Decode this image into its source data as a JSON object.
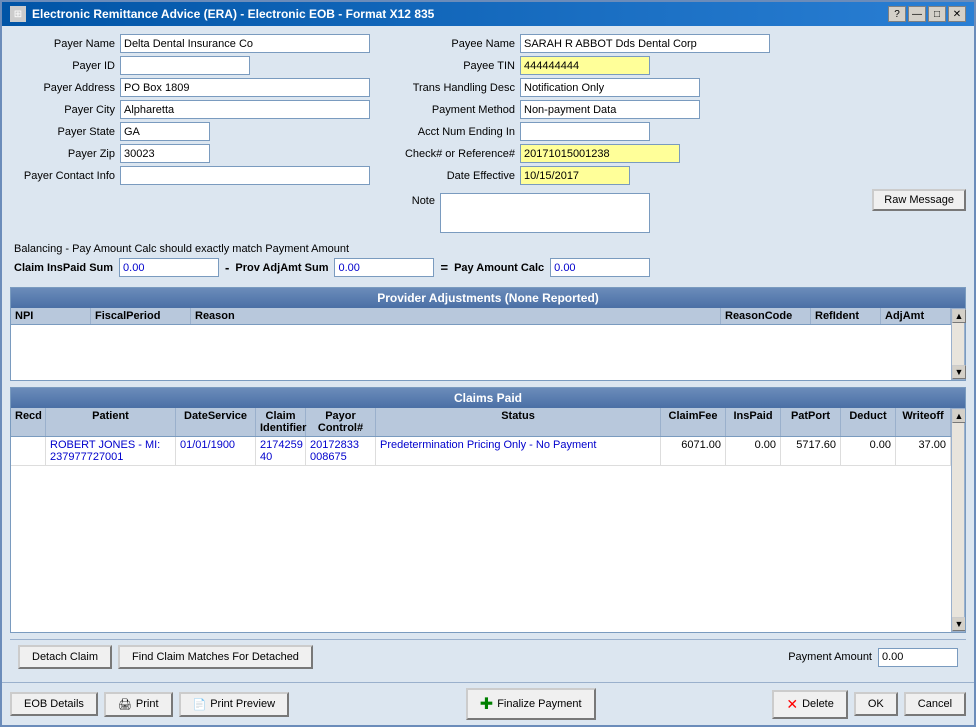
{
  "window": {
    "title": "Electronic Remittance Advice (ERA) - Electronic EOB - Format X12 835",
    "icon": "⊞"
  },
  "titlebar": {
    "help": "?",
    "minimize": "—",
    "maximize": "□",
    "close": "✕"
  },
  "payer": {
    "name_label": "Payer Name",
    "name_value": "Delta Dental Insurance Co",
    "id_label": "Payer ID",
    "id_value": "",
    "address_label": "Payer Address",
    "address_value": "PO Box 1809",
    "city_label": "Payer City",
    "city_value": "Alpharetta",
    "state_label": "Payer State",
    "state_value": "GA",
    "zip_label": "Payer Zip",
    "zip_value": "30023",
    "contact_label": "Payer Contact Info",
    "contact_value": ""
  },
  "payee": {
    "name_label": "Payee Name",
    "name_value": "SARAH R ABBOT Dds Dental Corp",
    "tin_label": "Payee TIN",
    "tin_value": "444444444",
    "trans_label": "Trans Handling Desc",
    "trans_value": "Notification Only",
    "payment_label": "Payment Method",
    "payment_value": "Non-payment Data",
    "acct_label": "Acct Num Ending In",
    "acct_value": "",
    "check_label": "Check# or Reference#",
    "check_value": "20171015001238",
    "date_label": "Date Effective",
    "date_value": "10/15/2017"
  },
  "raw_message_btn": "Raw Message",
  "note_label": "Note",
  "balance": {
    "title": "Balancing - Pay Amount Calc should exactly match Payment Amount",
    "claim_label": "Claim InsPaid Sum",
    "minus": "-",
    "prov_label": "Prov AdjAmt Sum",
    "equals": "=",
    "pay_label": "Pay Amount Calc",
    "claim_value": "0.00",
    "prov_value": "0.00",
    "pay_value": "0.00"
  },
  "provider_adjustments": {
    "header": "Provider Adjustments (None Reported)",
    "columns": [
      "NPI",
      "FiscalPeriod",
      "Reason",
      "ReasonCode",
      "RefIdent",
      "AdjAmt"
    ],
    "rows": []
  },
  "claims_paid": {
    "header": "Claims Paid",
    "columns": [
      "Recd",
      "Patient",
      "DateService",
      "Claim Identifier",
      "Payor Control#",
      "Status",
      "ClaimFee",
      "InsPaid",
      "PatPort",
      "Deduct",
      "Writeoff"
    ],
    "rows": [
      {
        "recd": "",
        "patient": "ROBERT JONES - MI: 237977727001",
        "date_service": "01/01/1900",
        "claim_id": "2174259 40",
        "payor_control": "20172833 008675",
        "status": "Predetermination Pricing Only - No Payment",
        "claim_fee": "6071.00",
        "ins_paid": "0.00",
        "pat_port": "5717.60",
        "deduct": "0.00",
        "writeoff": "37.00"
      }
    ]
  },
  "bottom": {
    "detach_claim": "Detach Claim",
    "find_claim": "Find Claim Matches For Detached",
    "payment_amount_label": "Payment Amount",
    "payment_amount_value": "0.00"
  },
  "footer": {
    "eob_details": "EOB Details",
    "print": "Print",
    "print_preview": "Print Preview",
    "finalize": "Finalize Payment",
    "delete": "Delete",
    "ok": "OK",
    "cancel": "Cancel"
  }
}
